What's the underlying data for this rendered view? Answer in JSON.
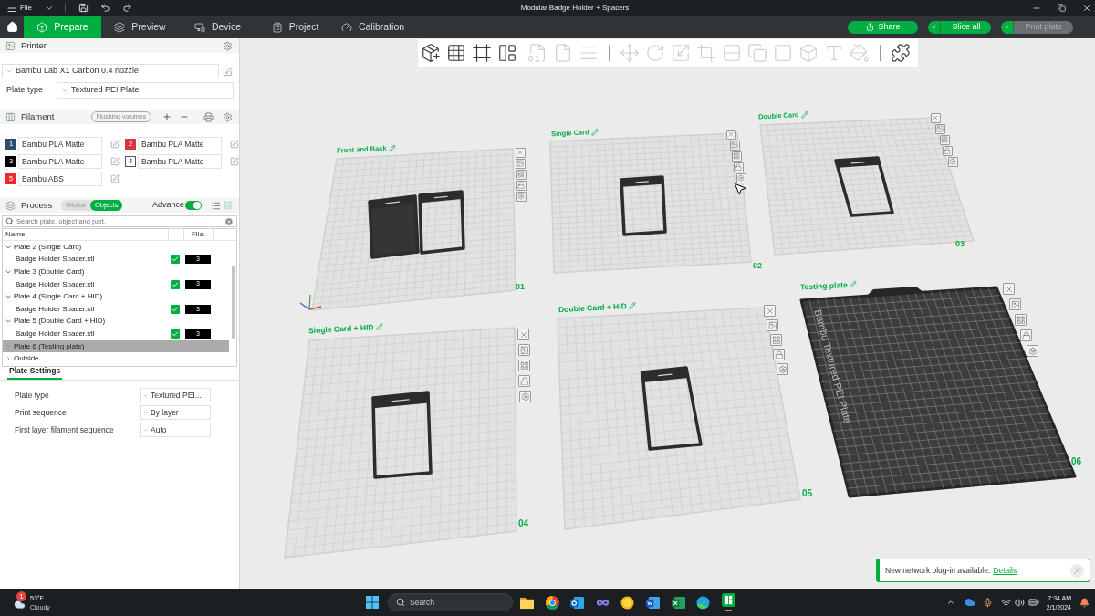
{
  "title_bar": {
    "menu": "File",
    "title": "Modular Badge Holder + Spacers"
  },
  "tabs": [
    {
      "label": "Prepare",
      "selected": true
    },
    {
      "label": "Preview",
      "selected": false
    },
    {
      "label": "Device",
      "selected": false
    },
    {
      "label": "Project",
      "selected": false
    },
    {
      "label": "Calibration",
      "selected": false
    }
  ],
  "actions": [
    {
      "label": "Share",
      "kind": "single",
      "disabled": false
    },
    {
      "label": "Slice all",
      "kind": "split",
      "disabled": false
    },
    {
      "label": "Print plate",
      "kind": "split",
      "disabled": true
    }
  ],
  "printer": {
    "title": "Printer",
    "preset": "Bambu Lab X1 Carbon 0.4 nozzle",
    "plate_type_label": "Plate type",
    "plate_type": "Textured PEI Plate"
  },
  "filament": {
    "title": "Filament",
    "flushing_button": "Flushing volumes",
    "slots": [
      {
        "number": "1",
        "name": "Bambu PLA Matte",
        "color": "#2d4b6f"
      },
      {
        "number": "2",
        "name": "Bambu PLA Matte",
        "color": "#d8343d"
      },
      {
        "number": "3",
        "name": "Bambu PLA Matte",
        "color": "#000000"
      },
      {
        "number": "4",
        "name": "Bambu PLA Matte",
        "color": "#ffffff"
      },
      {
        "number": "5",
        "name": "Bambu ABS",
        "color": "#ee2a30"
      }
    ]
  },
  "process": {
    "title": "Process",
    "modes": [
      {
        "label": "Global",
        "selected": false
      },
      {
        "label": "Objects",
        "selected": true
      }
    ],
    "advance": {
      "label": "Advance",
      "on": true
    }
  },
  "object_list": {
    "search_placeholder": "Search plate, object and part.",
    "columns": [
      "Name",
      "Fila."
    ],
    "items": [
      {
        "label": "Plate 2 (Single Card)",
        "expanded": true,
        "selected": false,
        "children": [
          {
            "label": "Badge Holder Spacer.stl",
            "checked": true,
            "filament": "3",
            "selected": false
          }
        ]
      },
      {
        "label": "Plate 3 (Double Card)",
        "expanded": true,
        "selected": false,
        "children": [
          {
            "label": "Badge Holder Spacer.stl",
            "checked": true,
            "filament": "3",
            "selected": false
          }
        ]
      },
      {
        "label": "Plate 4 (Single Card + HID)",
        "expanded": true,
        "selected": false,
        "children": [
          {
            "label": "Badge Holder Spacer.stl",
            "checked": true,
            "filament": "3",
            "selected": false
          }
        ]
      },
      {
        "label": "Plate 5 (Double Card + HID)",
        "expanded": true,
        "selected": false,
        "children": [
          {
            "label": "Badge Holder Spacer.stl",
            "checked": true,
            "filament": "3",
            "selected": false
          }
        ]
      },
      {
        "label": "Plate 6 (Testing plate)",
        "expanded": false,
        "selected": true
      },
      {
        "label": "Outside",
        "expanded": false,
        "selected": false
      }
    ]
  },
  "plate_settings": {
    "tab": {
      "label": "Plate Settings",
      "selected": true
    },
    "rows": [
      {
        "label": "Plate type",
        "value": "Textured PEI..."
      },
      {
        "label": "Print sequence",
        "value": "By layer"
      },
      {
        "label": "First layer filament sequence",
        "value": "Auto"
      }
    ]
  },
  "toolbar": [
    [
      {
        "disabled": false
      },
      {
        "disabled": false
      },
      {
        "disabled": false
      },
      {
        "disabled": false
      },
      {
        "disabled": true
      },
      {
        "disabled": true
      },
      {
        "disabled": true
      }
    ],
    [
      {
        "disabled": true
      },
      {
        "disabled": true
      },
      {
        "disabled": true
      },
      {
        "disabled": true
      },
      {
        "disabled": true
      },
      {
        "disabled": true
      },
      {
        "disabled": true
      },
      {
        "disabled": true
      },
      {
        "disabled": true
      },
      {
        "disabled": true
      }
    ],
    [
      {
        "disabled": false
      }
    ]
  ],
  "plates": [
    {
      "name": "Front and Back",
      "number": "01",
      "kind": "light"
    },
    {
      "name": "Single Card",
      "number": "02",
      "kind": "light"
    },
    {
      "name": "Double Card",
      "number": "03",
      "kind": "light"
    },
    {
      "name": "Single Card + HID",
      "number": "04",
      "kind": "light"
    },
    {
      "name": "Double Card + HID",
      "number": "05",
      "kind": "light"
    },
    {
      "name": "Testing plate",
      "number": "06",
      "kind": "dark",
      "texture_text": "Bambu Textured PEI Plate"
    }
  ],
  "notification": {
    "message": "New network plug-in available.",
    "link": "Details"
  },
  "taskbar": {
    "weather_badge": "1",
    "temperature": "53°F",
    "condition": "Cloudy",
    "search_placeholder": "Search",
    "apps": [
      {
        "kind": "folder",
        "active": false
      },
      {
        "kind": "wheel",
        "active": false
      },
      {
        "kind": "mail",
        "active": false
      },
      {
        "kind": "loop",
        "active": false
      },
      {
        "kind": "disc",
        "active": false
      },
      {
        "kind": "document",
        "active": false
      },
      {
        "kind": "sheet",
        "active": false
      },
      {
        "kind": "swirl",
        "active": false
      },
      {
        "kind": "tile",
        "active": true
      }
    ],
    "time": "7:34 AM",
    "date": "2/1/2024"
  }
}
